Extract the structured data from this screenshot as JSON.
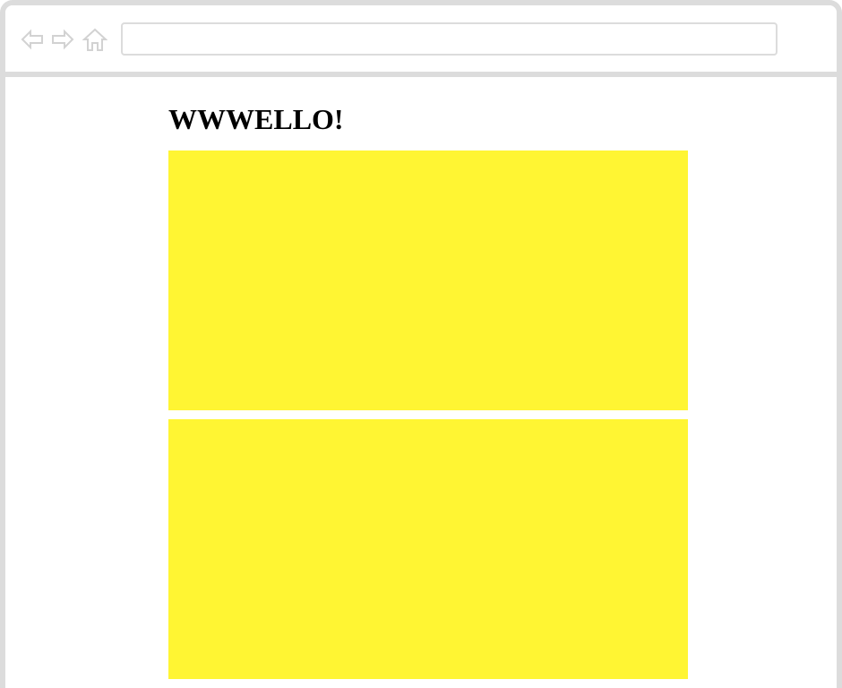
{
  "browser": {
    "address_bar": {
      "value": "",
      "placeholder": ""
    },
    "icons": {
      "back": "back-arrow-icon",
      "forward": "forward-arrow-icon",
      "home": "home-icon"
    },
    "chrome_color": "#dcdcdc"
  },
  "page": {
    "title": "WWWELLO!",
    "blocks": [
      {
        "color": "#fff533"
      },
      {
        "color": "#fff533"
      }
    ]
  }
}
